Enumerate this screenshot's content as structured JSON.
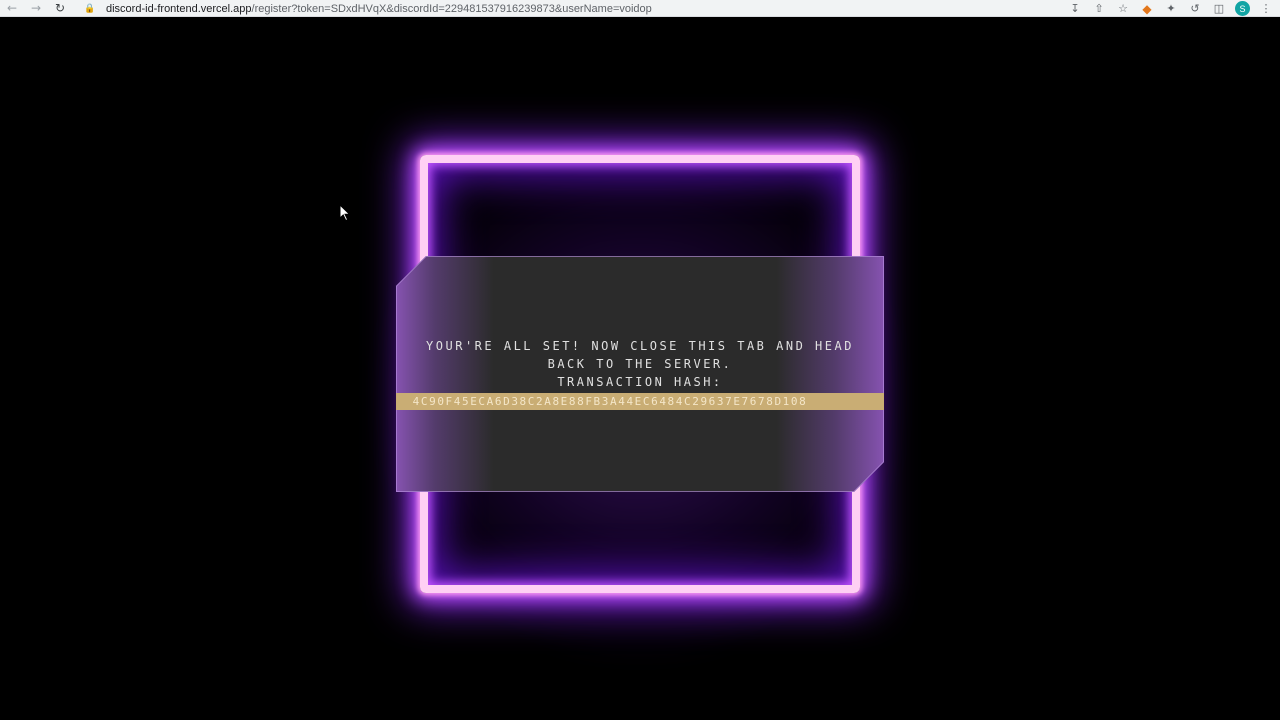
{
  "browser": {
    "url_host": "discord-id-frontend.vercel.app",
    "url_path": "/register?token=SDxdHVqX&discordId=229481537916239873&userName=voidop",
    "avatar_letter": "S"
  },
  "icons": {
    "back": "arrow-left-icon",
    "forward": "arrow-right-icon",
    "reload": "reload-icon",
    "lock": "lock-icon",
    "download": "download-icon",
    "share": "share-icon",
    "bookmark": "star-icon",
    "metamask": "metamask-fox-icon",
    "extensions": "puzzle-icon",
    "sync": "sync-icon",
    "sidebar": "sidebar-icon",
    "menu": "kebab-menu-icon"
  },
  "card": {
    "line1": "YOUR'RE ALL SET! NOW CLOSE THIS TAB AND HEAD",
    "line2": "BACK TO THE SERVER.",
    "line3": "TRANSACTION HASH:",
    "hash": "4C90F45ECA6D38C2A8E88FB3A44EC6484C29637E7678D108"
  },
  "colors": {
    "neon": "#ffd0f4",
    "neon_glow": "#c054ff",
    "card_bg": "#2b2b2b",
    "hash_bar": "#c9ad74"
  }
}
